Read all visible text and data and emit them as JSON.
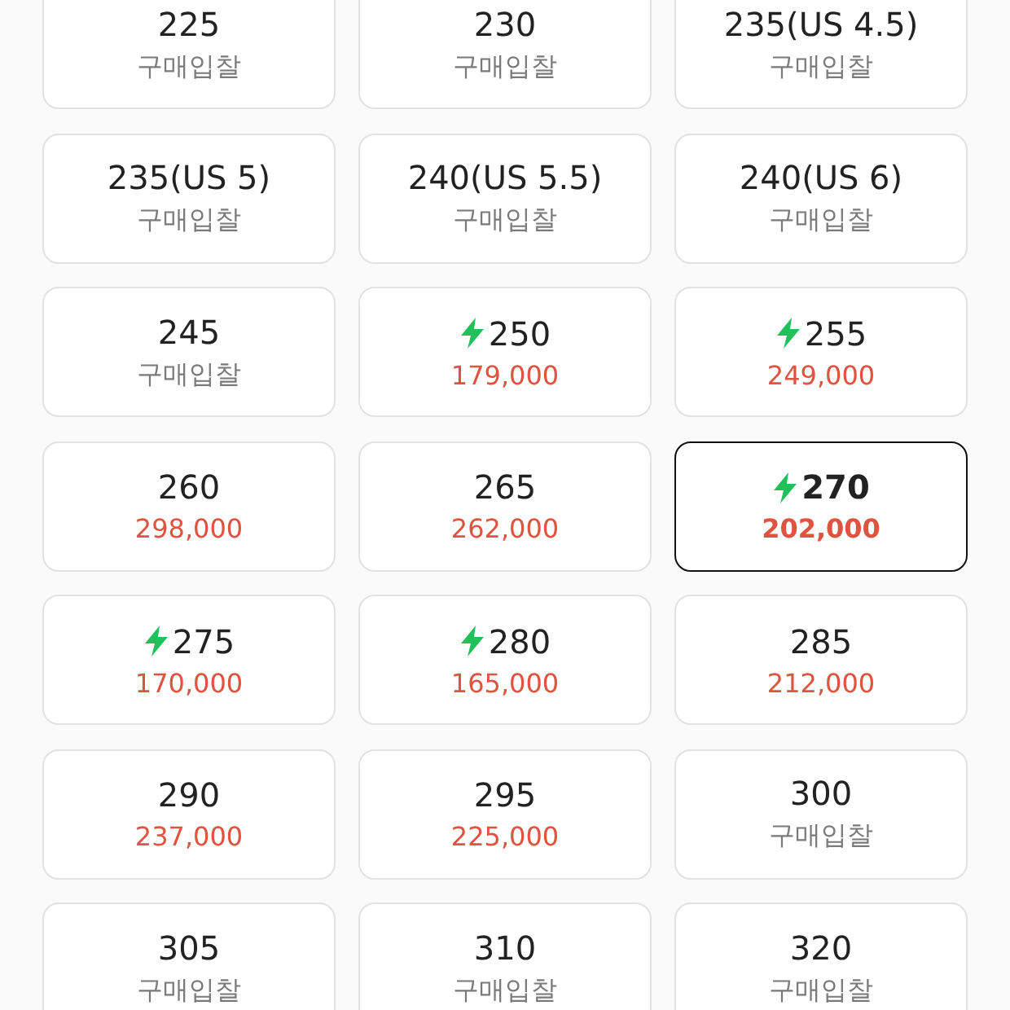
{
  "sizes": [
    {
      "size": "225",
      "fast": false,
      "sub": "구매입찰",
      "kind": "bid",
      "selected": false
    },
    {
      "size": "230",
      "fast": false,
      "sub": "구매입찰",
      "kind": "bid",
      "selected": false
    },
    {
      "size": "235(US 4.5)",
      "fast": false,
      "sub": "구매입찰",
      "kind": "bid",
      "selected": false
    },
    {
      "size": "235(US 5)",
      "fast": false,
      "sub": "구매입찰",
      "kind": "bid",
      "selected": false
    },
    {
      "size": "240(US 5.5)",
      "fast": false,
      "sub": "구매입찰",
      "kind": "bid",
      "selected": false
    },
    {
      "size": "240(US 6)",
      "fast": false,
      "sub": "구매입찰",
      "kind": "bid",
      "selected": false
    },
    {
      "size": "245",
      "fast": false,
      "sub": "구매입찰",
      "kind": "bid",
      "selected": false
    },
    {
      "size": "250",
      "fast": true,
      "sub": "179,000",
      "kind": "price",
      "selected": false
    },
    {
      "size": "255",
      "fast": true,
      "sub": "249,000",
      "kind": "price",
      "selected": false
    },
    {
      "size": "260",
      "fast": false,
      "sub": "298,000",
      "kind": "price",
      "selected": false
    },
    {
      "size": "265",
      "fast": false,
      "sub": "262,000",
      "kind": "price",
      "selected": false
    },
    {
      "size": "270",
      "fast": true,
      "sub": "202,000",
      "kind": "price",
      "selected": true
    },
    {
      "size": "275",
      "fast": true,
      "sub": "170,000",
      "kind": "price",
      "selected": false
    },
    {
      "size": "280",
      "fast": true,
      "sub": "165,000",
      "kind": "price",
      "selected": false
    },
    {
      "size": "285",
      "fast": false,
      "sub": "212,000",
      "kind": "price",
      "selected": false
    },
    {
      "size": "290",
      "fast": false,
      "sub": "237,000",
      "kind": "price",
      "selected": false
    },
    {
      "size": "295",
      "fast": false,
      "sub": "225,000",
      "kind": "price",
      "selected": false
    },
    {
      "size": "300",
      "fast": false,
      "sub": "구매입찰",
      "kind": "bid",
      "selected": false
    },
    {
      "size": "305",
      "fast": false,
      "sub": "구매입찰",
      "kind": "bid",
      "selected": false
    },
    {
      "size": "310",
      "fast": false,
      "sub": "구매입찰",
      "kind": "bid",
      "selected": false
    },
    {
      "size": "320",
      "fast": false,
      "sub": "구매입찰",
      "kind": "bid",
      "selected": false
    }
  ]
}
